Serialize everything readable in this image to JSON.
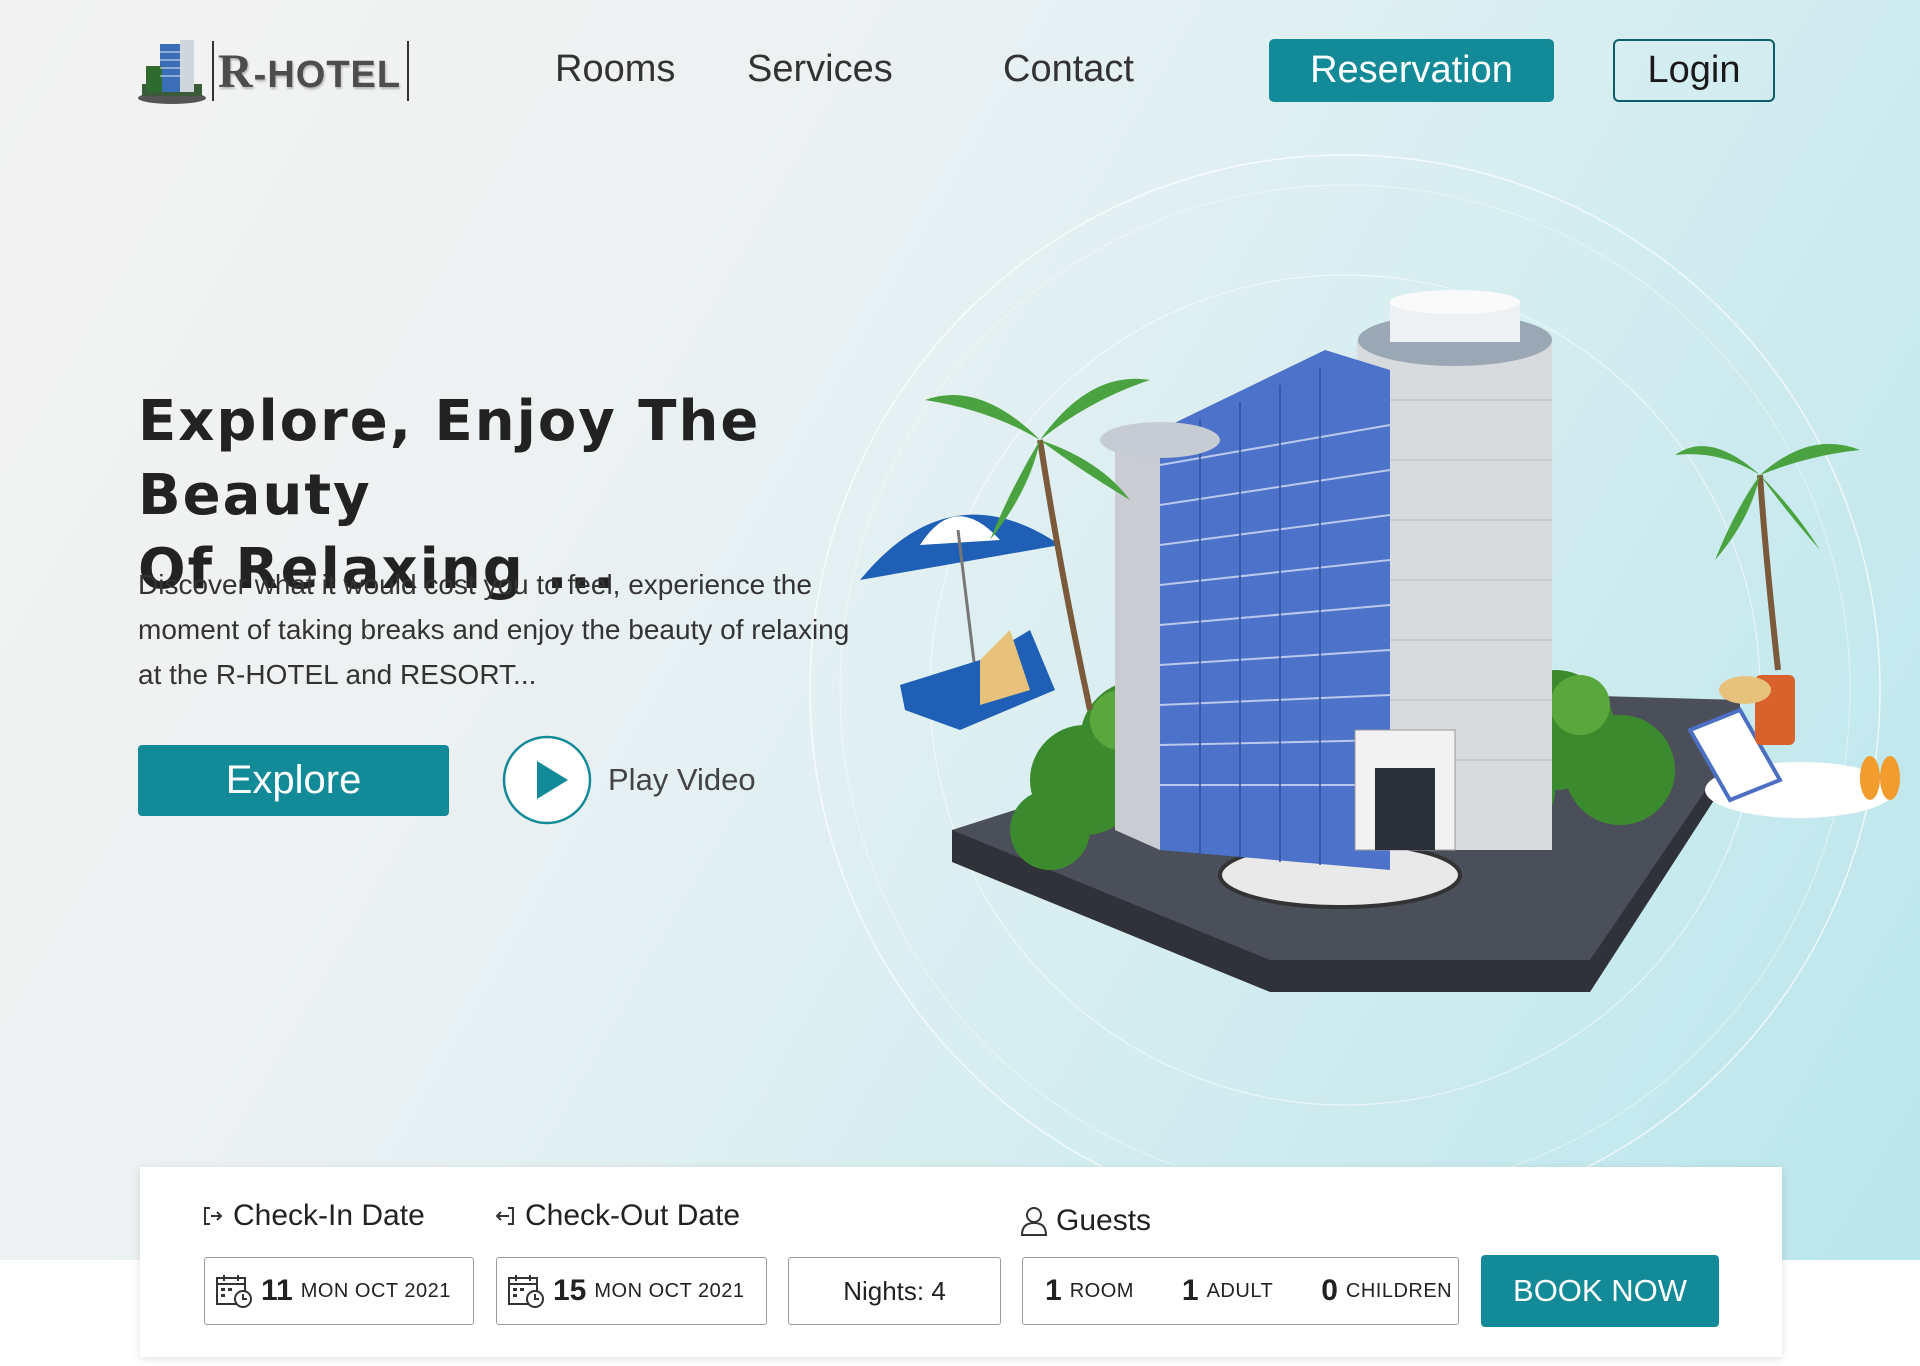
{
  "brand": {
    "mark": "R",
    "rest": "-HOTEL"
  },
  "nav": {
    "rooms": "Rooms",
    "services": "Services",
    "contact": "Contact",
    "reservation": "Reservation",
    "login": "Login"
  },
  "hero": {
    "title_line1": "Explore, Enjoy The Beauty",
    "title_line2": "Of Relaxing ...",
    "description": "Discover what it would cost you to feel, experience the moment of taking breaks and enjoy the beauty of relaxing at the R-HOTEL and RESORT...",
    "explore_label": "Explore",
    "play_label": "Play Video"
  },
  "booking": {
    "checkin_label": "Check-In Date",
    "checkout_label": "Check-Out Date",
    "guests_label": "Guests",
    "checkin_day": "11",
    "checkin_date": "MON OCT 2021",
    "checkout_day": "15",
    "checkout_date": "MON OCT 2021",
    "nights": "Nights: 4",
    "rooms_count": "1",
    "rooms_label": "ROOM",
    "adults_count": "1",
    "adults_label": "ADULT",
    "children_count": "0",
    "children_label": "CHILDREN",
    "book_label": "BOOK NOW"
  },
  "colors": {
    "accent": "#138a97",
    "dark_accent": "#0d5e68"
  },
  "icons": [
    "building-logo-icon",
    "play-icon",
    "checkin-icon",
    "checkout-icon",
    "user-icon",
    "calendar-clock-icon"
  ]
}
